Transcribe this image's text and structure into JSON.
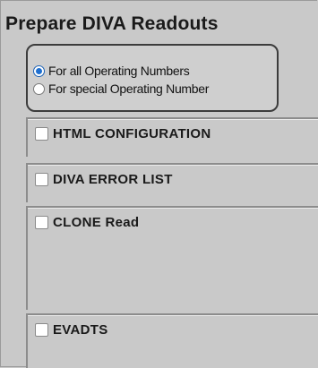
{
  "panel": {
    "title": "Prepare DIVA Readouts"
  },
  "radio_group": {
    "options": [
      {
        "label": "For all Operating Numbers",
        "selected": true
      },
      {
        "label": "For special Operating Number",
        "selected": false
      }
    ]
  },
  "sections": [
    {
      "label": "HTML CONFIGURATION",
      "checked": false
    },
    {
      "label": "DIVA ERROR LIST",
      "checked": false
    },
    {
      "label": "CLONE Read",
      "checked": false
    },
    {
      "label": "EVADTS",
      "checked": false
    }
  ],
  "colors": {
    "background": "#c9c9c9",
    "radio_accent": "#1e6fd0"
  }
}
